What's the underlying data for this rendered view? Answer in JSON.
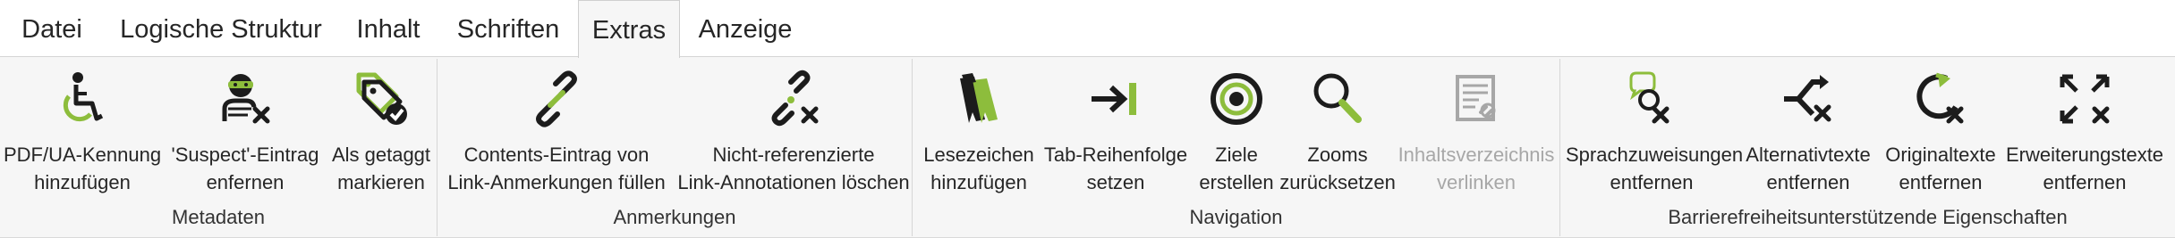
{
  "tabs": [
    {
      "label": "Datei"
    },
    {
      "label": "Logische Struktur"
    },
    {
      "label": "Inhalt"
    },
    {
      "label": "Schriften"
    },
    {
      "label": "Extras"
    },
    {
      "label": "Anzeige"
    }
  ],
  "active_tab": "Extras",
  "colors": {
    "accent_green": "#8dbd3c",
    "icon_dark": "#1c1c1c",
    "disabled": "#a7a7a7"
  },
  "groups": [
    {
      "label": "Metadaten",
      "buttons": [
        {
          "line1": "PDF/UA-Kennung",
          "line2": "hinzufügen",
          "icon": "accessibility-icon"
        },
        {
          "line1": "'Suspect'-Eintrag",
          "line2": "enfernen",
          "icon": "suspect-remove-icon"
        },
        {
          "line1": "Als getaggt",
          "line2": "markieren",
          "icon": "tag-check-icon"
        }
      ]
    },
    {
      "label": "Anmerkungen",
      "buttons": [
        {
          "line1": "Contents-Eintrag von",
          "line2": "Link-Anmerkungen füllen",
          "icon": "link-icon"
        },
        {
          "line1": "Nicht-referenzierte",
          "line2": "Link-Annotationen löschen",
          "icon": "broken-link-remove-icon"
        }
      ]
    },
    {
      "label": "Navigation",
      "buttons": [
        {
          "line1": "Lesezeichen",
          "line2": "hinzufügen",
          "icon": "bookmarks-icon"
        },
        {
          "line1": "Tab-Reihenfolge",
          "line2": "setzen",
          "icon": "tab-order-icon"
        },
        {
          "line1": "Ziele",
          "line2": "erstellen",
          "icon": "target-icon"
        },
        {
          "line1": "Zooms",
          "line2": "zurücksetzen",
          "icon": "zoom-icon"
        },
        {
          "line1": "Inhaltsverzeichnis",
          "line2": "verlinken",
          "icon": "toc-link-icon",
          "disabled": true
        }
      ]
    },
    {
      "label": "Barrierefreiheitsunterstützende Eigenschaften",
      "buttons": [
        {
          "line1": "Sprachzuweisungen",
          "line2": "entfernen",
          "icon": "language-remove-icon"
        },
        {
          "line1": "Alternativtexte",
          "line2": "entfernen",
          "icon": "alt-text-remove-icon"
        },
        {
          "line1": "Originaltexte",
          "line2": "entfernen",
          "icon": "original-text-remove-icon"
        },
        {
          "line1": "Erweiterungstexte",
          "line2": "entfernen",
          "icon": "expansion-text-remove-icon"
        }
      ]
    }
  ]
}
